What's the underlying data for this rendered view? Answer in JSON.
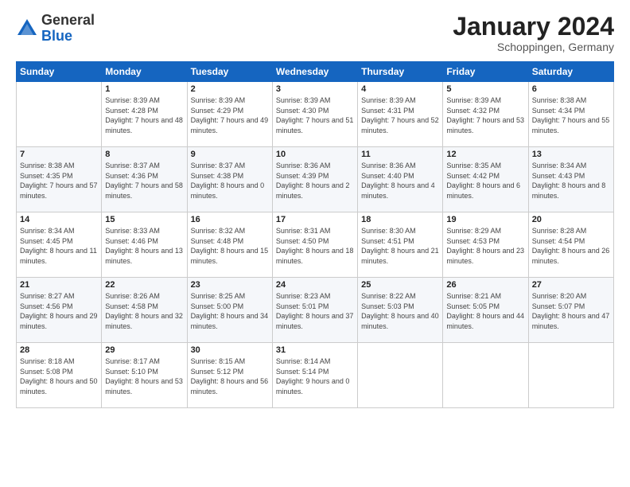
{
  "header": {
    "logo_general": "General",
    "logo_blue": "Blue",
    "month_title": "January 2024",
    "subtitle": "Schoppingen, Germany"
  },
  "days_of_week": [
    "Sunday",
    "Monday",
    "Tuesday",
    "Wednesday",
    "Thursday",
    "Friday",
    "Saturday"
  ],
  "weeks": [
    [
      {
        "day": "",
        "sunrise": "",
        "sunset": "",
        "daylight": ""
      },
      {
        "day": "1",
        "sunrise": "Sunrise: 8:39 AM",
        "sunset": "Sunset: 4:28 PM",
        "daylight": "Daylight: 7 hours and 48 minutes."
      },
      {
        "day": "2",
        "sunrise": "Sunrise: 8:39 AM",
        "sunset": "Sunset: 4:29 PM",
        "daylight": "Daylight: 7 hours and 49 minutes."
      },
      {
        "day": "3",
        "sunrise": "Sunrise: 8:39 AM",
        "sunset": "Sunset: 4:30 PM",
        "daylight": "Daylight: 7 hours and 51 minutes."
      },
      {
        "day": "4",
        "sunrise": "Sunrise: 8:39 AM",
        "sunset": "Sunset: 4:31 PM",
        "daylight": "Daylight: 7 hours and 52 minutes."
      },
      {
        "day": "5",
        "sunrise": "Sunrise: 8:39 AM",
        "sunset": "Sunset: 4:32 PM",
        "daylight": "Daylight: 7 hours and 53 minutes."
      },
      {
        "day": "6",
        "sunrise": "Sunrise: 8:38 AM",
        "sunset": "Sunset: 4:34 PM",
        "daylight": "Daylight: 7 hours and 55 minutes."
      }
    ],
    [
      {
        "day": "7",
        "sunrise": "Sunrise: 8:38 AM",
        "sunset": "Sunset: 4:35 PM",
        "daylight": "Daylight: 7 hours and 57 minutes."
      },
      {
        "day": "8",
        "sunrise": "Sunrise: 8:37 AM",
        "sunset": "Sunset: 4:36 PM",
        "daylight": "Daylight: 7 hours and 58 minutes."
      },
      {
        "day": "9",
        "sunrise": "Sunrise: 8:37 AM",
        "sunset": "Sunset: 4:38 PM",
        "daylight": "Daylight: 8 hours and 0 minutes."
      },
      {
        "day": "10",
        "sunrise": "Sunrise: 8:36 AM",
        "sunset": "Sunset: 4:39 PM",
        "daylight": "Daylight: 8 hours and 2 minutes."
      },
      {
        "day": "11",
        "sunrise": "Sunrise: 8:36 AM",
        "sunset": "Sunset: 4:40 PM",
        "daylight": "Daylight: 8 hours and 4 minutes."
      },
      {
        "day": "12",
        "sunrise": "Sunrise: 8:35 AM",
        "sunset": "Sunset: 4:42 PM",
        "daylight": "Daylight: 8 hours and 6 minutes."
      },
      {
        "day": "13",
        "sunrise": "Sunrise: 8:34 AM",
        "sunset": "Sunset: 4:43 PM",
        "daylight": "Daylight: 8 hours and 8 minutes."
      }
    ],
    [
      {
        "day": "14",
        "sunrise": "Sunrise: 8:34 AM",
        "sunset": "Sunset: 4:45 PM",
        "daylight": "Daylight: 8 hours and 11 minutes."
      },
      {
        "day": "15",
        "sunrise": "Sunrise: 8:33 AM",
        "sunset": "Sunset: 4:46 PM",
        "daylight": "Daylight: 8 hours and 13 minutes."
      },
      {
        "day": "16",
        "sunrise": "Sunrise: 8:32 AM",
        "sunset": "Sunset: 4:48 PM",
        "daylight": "Daylight: 8 hours and 15 minutes."
      },
      {
        "day": "17",
        "sunrise": "Sunrise: 8:31 AM",
        "sunset": "Sunset: 4:50 PM",
        "daylight": "Daylight: 8 hours and 18 minutes."
      },
      {
        "day": "18",
        "sunrise": "Sunrise: 8:30 AM",
        "sunset": "Sunset: 4:51 PM",
        "daylight": "Daylight: 8 hours and 21 minutes."
      },
      {
        "day": "19",
        "sunrise": "Sunrise: 8:29 AM",
        "sunset": "Sunset: 4:53 PM",
        "daylight": "Daylight: 8 hours and 23 minutes."
      },
      {
        "day": "20",
        "sunrise": "Sunrise: 8:28 AM",
        "sunset": "Sunset: 4:54 PM",
        "daylight": "Daylight: 8 hours and 26 minutes."
      }
    ],
    [
      {
        "day": "21",
        "sunrise": "Sunrise: 8:27 AM",
        "sunset": "Sunset: 4:56 PM",
        "daylight": "Daylight: 8 hours and 29 minutes."
      },
      {
        "day": "22",
        "sunrise": "Sunrise: 8:26 AM",
        "sunset": "Sunset: 4:58 PM",
        "daylight": "Daylight: 8 hours and 32 minutes."
      },
      {
        "day": "23",
        "sunrise": "Sunrise: 8:25 AM",
        "sunset": "Sunset: 5:00 PM",
        "daylight": "Daylight: 8 hours and 34 minutes."
      },
      {
        "day": "24",
        "sunrise": "Sunrise: 8:23 AM",
        "sunset": "Sunset: 5:01 PM",
        "daylight": "Daylight: 8 hours and 37 minutes."
      },
      {
        "day": "25",
        "sunrise": "Sunrise: 8:22 AM",
        "sunset": "Sunset: 5:03 PM",
        "daylight": "Daylight: 8 hours and 40 minutes."
      },
      {
        "day": "26",
        "sunrise": "Sunrise: 8:21 AM",
        "sunset": "Sunset: 5:05 PM",
        "daylight": "Daylight: 8 hours and 44 minutes."
      },
      {
        "day": "27",
        "sunrise": "Sunrise: 8:20 AM",
        "sunset": "Sunset: 5:07 PM",
        "daylight": "Daylight: 8 hours and 47 minutes."
      }
    ],
    [
      {
        "day": "28",
        "sunrise": "Sunrise: 8:18 AM",
        "sunset": "Sunset: 5:08 PM",
        "daylight": "Daylight: 8 hours and 50 minutes."
      },
      {
        "day": "29",
        "sunrise": "Sunrise: 8:17 AM",
        "sunset": "Sunset: 5:10 PM",
        "daylight": "Daylight: 8 hours and 53 minutes."
      },
      {
        "day": "30",
        "sunrise": "Sunrise: 8:15 AM",
        "sunset": "Sunset: 5:12 PM",
        "daylight": "Daylight: 8 hours and 56 minutes."
      },
      {
        "day": "31",
        "sunrise": "Sunrise: 8:14 AM",
        "sunset": "Sunset: 5:14 PM",
        "daylight": "Daylight: 9 hours and 0 minutes."
      },
      {
        "day": "",
        "sunrise": "",
        "sunset": "",
        "daylight": ""
      },
      {
        "day": "",
        "sunrise": "",
        "sunset": "",
        "daylight": ""
      },
      {
        "day": "",
        "sunrise": "",
        "sunset": "",
        "daylight": ""
      }
    ]
  ]
}
